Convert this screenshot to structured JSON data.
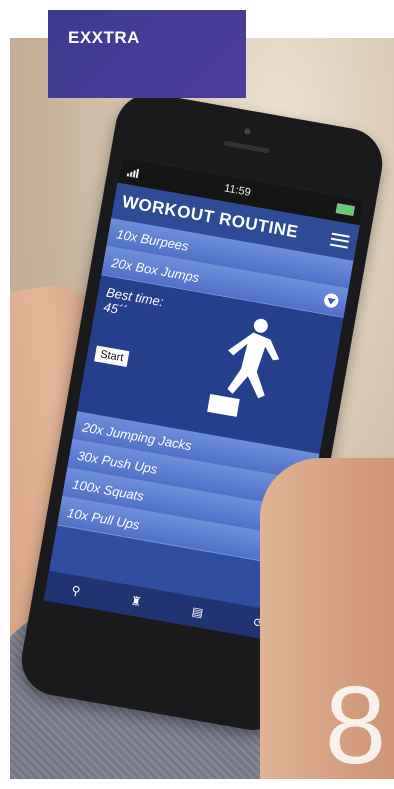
{
  "badge": {
    "label": "EXXTRA"
  },
  "page_number": "8",
  "phone": {
    "status": {
      "time": "11:59"
    },
    "app_title": "WORKOUT ROUTINE",
    "exercises_top": [
      {
        "label": "10x Burpees",
        "icon": "none"
      },
      {
        "label": "20x Box Jumps",
        "icon": "play-icon"
      }
    ],
    "detail": {
      "best_time_label": "Best time:",
      "best_time_value": "45´´",
      "start_label": "Start"
    },
    "exercises_bottom": [
      {
        "label": "20x Jumping Jacks",
        "icon": "none"
      },
      {
        "label": "30x Push Ups",
        "icon": "play-icon"
      },
      {
        "label": "100x Squats",
        "icon": "play-icon"
      },
      {
        "label": "10x Pull Ups",
        "icon": "none"
      }
    ],
    "nav_icons": [
      "figure-icon",
      "runner-icon",
      "book-icon",
      "refresh-icon"
    ]
  },
  "colors": {
    "badge": "#3c3a90",
    "screen": "#2f4f9e",
    "row": "#5b7bd0"
  }
}
